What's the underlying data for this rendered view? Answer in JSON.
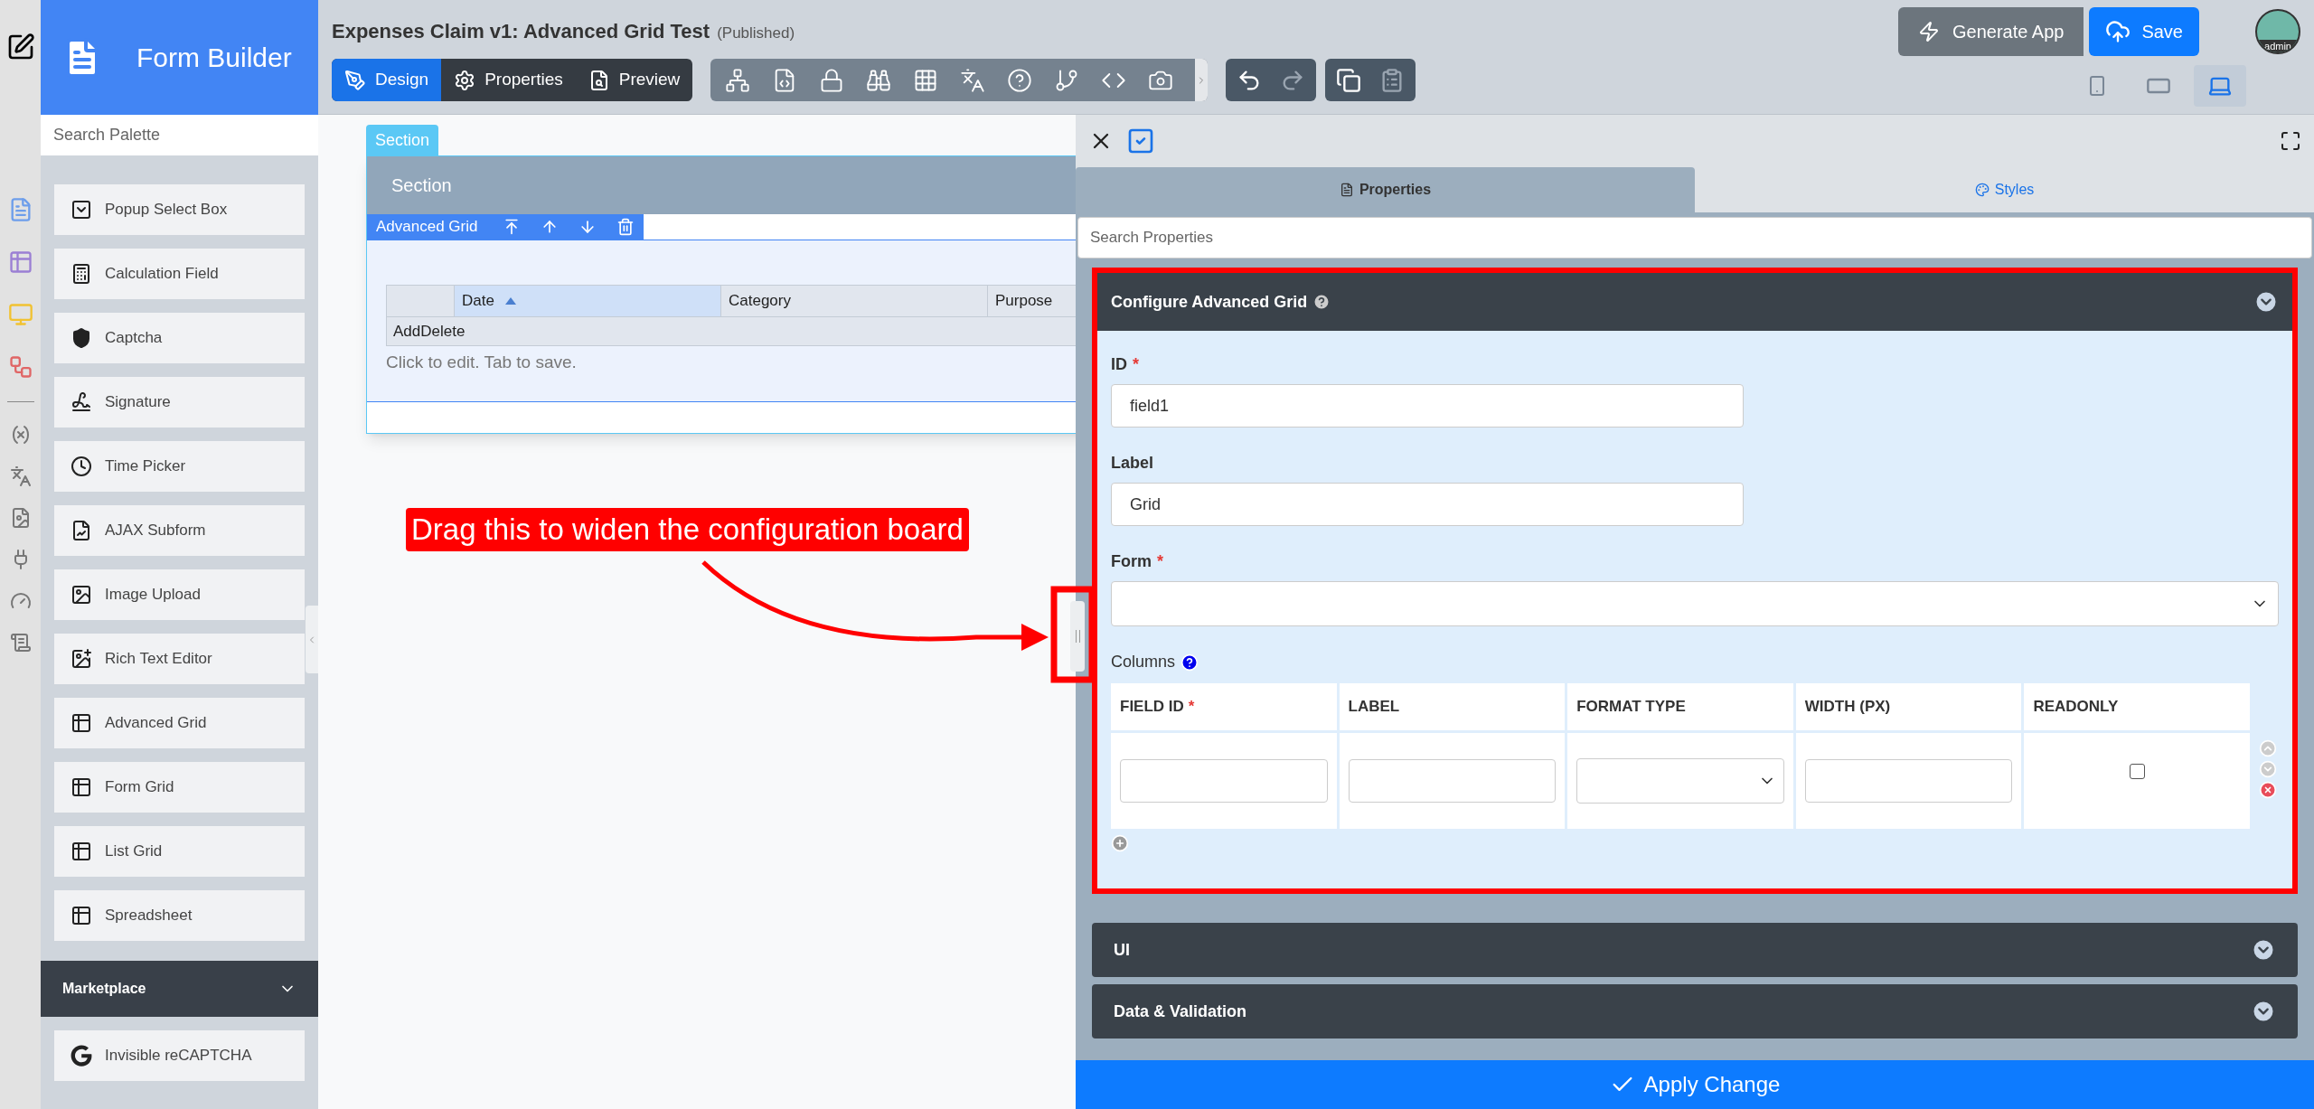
{
  "app": {
    "title": "Form Builder"
  },
  "palette": {
    "search_placeholder": "Search Palette",
    "items": [
      {
        "label": "Popup Select Box",
        "kind": "popup"
      },
      {
        "label": "Calculation Field",
        "kind": "calculator"
      },
      {
        "label": "Captcha",
        "kind": "shield"
      },
      {
        "label": "Signature",
        "kind": "signature"
      },
      {
        "label": "Time Picker",
        "kind": "clock"
      },
      {
        "label": "AJAX Subform",
        "kind": "subform"
      },
      {
        "label": "Image Upload",
        "kind": "image"
      },
      {
        "label": "Rich Text Editor",
        "kind": "richtext"
      },
      {
        "label": "Advanced Grid",
        "kind": "grid"
      },
      {
        "label": "Form Grid",
        "kind": "grid"
      },
      {
        "label": "List Grid",
        "kind": "grid"
      },
      {
        "label": "Spreadsheet",
        "kind": "grid"
      }
    ],
    "marketplace": {
      "title": "Marketplace",
      "expanded": false,
      "items": [
        {
          "label": "Invisible reCAPTCHA",
          "kind": "google"
        }
      ]
    }
  },
  "header": {
    "title": "Expenses Claim v1: Advanced Grid Test",
    "status": "(Published)",
    "mode_tabs": [
      {
        "label": "Design",
        "kind": "design",
        "selected": true
      },
      {
        "label": "Properties",
        "kind": "properties",
        "selected": false
      },
      {
        "label": "Preview",
        "kind": "preview",
        "selected": false
      }
    ],
    "generate_button": "Generate App",
    "save_button": "Save",
    "user": "admin",
    "devices": [
      {
        "kind": "phone",
        "selected": false
      },
      {
        "kind": "tablet",
        "selected": false
      },
      {
        "kind": "laptop",
        "selected": true
      }
    ]
  },
  "canvas": {
    "section_tab": "Section",
    "section_title": "Section",
    "grid": {
      "label": "Advanced Grid",
      "columns": [
        {
          "label": "Date",
          "sorted": true
        },
        {
          "label": "Category",
          "sorted": false
        },
        {
          "label": "Purpose",
          "sorted": false
        }
      ],
      "footer": "AddDelete",
      "hint": "Click to edit. Tab to save."
    },
    "annotation": "Drag this to widen the configuration board"
  },
  "properties": {
    "tabs": [
      {
        "label": "Properties",
        "kind": "doc",
        "selected": true
      },
      {
        "label": "Styles",
        "kind": "palette",
        "selected": false
      }
    ],
    "search_placeholder": "Search Properties",
    "panel": {
      "title": "Configure Advanced Grid",
      "expanded": true,
      "fields": [
        {
          "label": "ID",
          "required_mark": "*",
          "kind": "text",
          "value": "field1"
        },
        {
          "label": "Label",
          "kind": "text",
          "value": "Grid"
        },
        {
          "label": "Form",
          "required_mark": "*",
          "kind": "select"
        }
      ],
      "columns_label": "Columns",
      "column_headers": [
        {
          "label": "FIELD ID",
          "required_mark": "*",
          "kind": "text"
        },
        {
          "label": "LABEL",
          "kind": "text"
        },
        {
          "label": "FORMAT TYPE",
          "kind": "select"
        },
        {
          "label": "WIDTH (PX)",
          "kind": "text"
        },
        {
          "label": "READONLY",
          "kind": "checkbox"
        }
      ],
      "row": {
        "readonly": false
      }
    },
    "sections": [
      {
        "title": "UI",
        "expanded": false
      },
      {
        "title": "Data & Validation",
        "expanded": false
      }
    ],
    "apply_button": "Apply Change"
  }
}
